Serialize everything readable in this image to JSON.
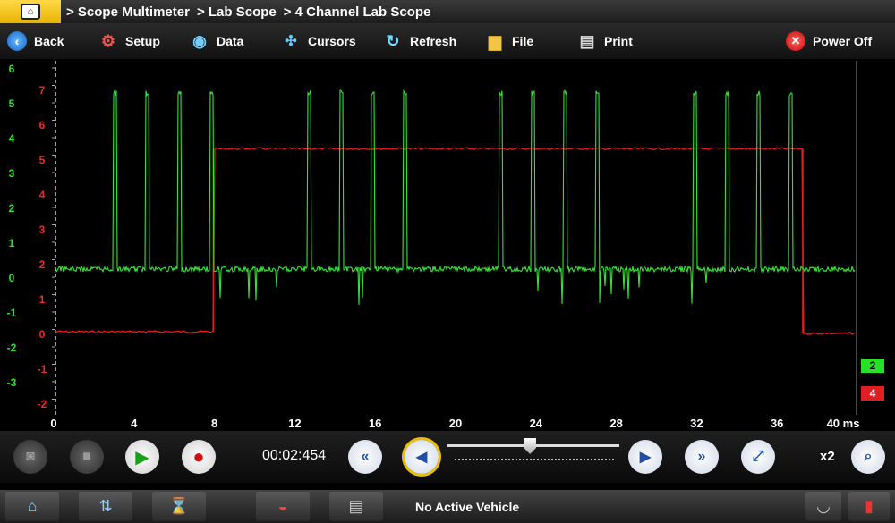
{
  "breadcrumb": [
    "> Scope Multimeter",
    "> Lab Scope",
    "> 4 Channel Lab Scope"
  ],
  "toolbar": {
    "back": "Back",
    "setup": "Setup",
    "data": "Data",
    "cursors": "Cursors",
    "refresh": "Refresh",
    "file": "File",
    "print": "Print",
    "power_off": "Power Off"
  },
  "icons": {
    "home": "home-icon",
    "back": "back-arrow-icon",
    "setup": "gear-icon",
    "data": "eye-icon",
    "cursors": "cursors-icon",
    "refresh": "refresh-icon",
    "file": "folder-icon",
    "print": "printer-icon",
    "power_off": "power-off-icon"
  },
  "scope": {
    "channel_badges": [
      {
        "label": "2",
        "color": "#27e027"
      },
      {
        "label": "4",
        "color": "#e02020"
      }
    ],
    "green_axis_labels": [
      "6",
      "5",
      "4",
      "3",
      "2",
      "1",
      "0",
      "-1",
      "-2",
      "-3"
    ],
    "red_axis_labels": [
      "7",
      "6",
      "5",
      "4",
      "3",
      "2",
      "1",
      "0",
      "-1",
      "-2"
    ],
    "time_ticks": [
      "0",
      "4",
      "8",
      "12",
      "16",
      "20",
      "24",
      "28",
      "32",
      "36",
      "40 ms"
    ],
    "green_pulse_times_ms": [
      3.0,
      4.6,
      6.2,
      7.8,
      12.7,
      14.3,
      15.9,
      17.5,
      22.3,
      23.9,
      25.5,
      27.1,
      32.0,
      33.6,
      35.2,
      36.8
    ],
    "red_high_start_ms": 7.9,
    "red_high_end_ms": 37.4,
    "colors": {
      "green_trace": "#3ae03a",
      "red_trace": "#e02020",
      "grid": "#7a7a7a"
    }
  },
  "playback": {
    "time": "00:02:454",
    "zoom": "x2",
    "slider_position": 0.48
  },
  "status": {
    "vehicle": "No Active Vehicle"
  }
}
